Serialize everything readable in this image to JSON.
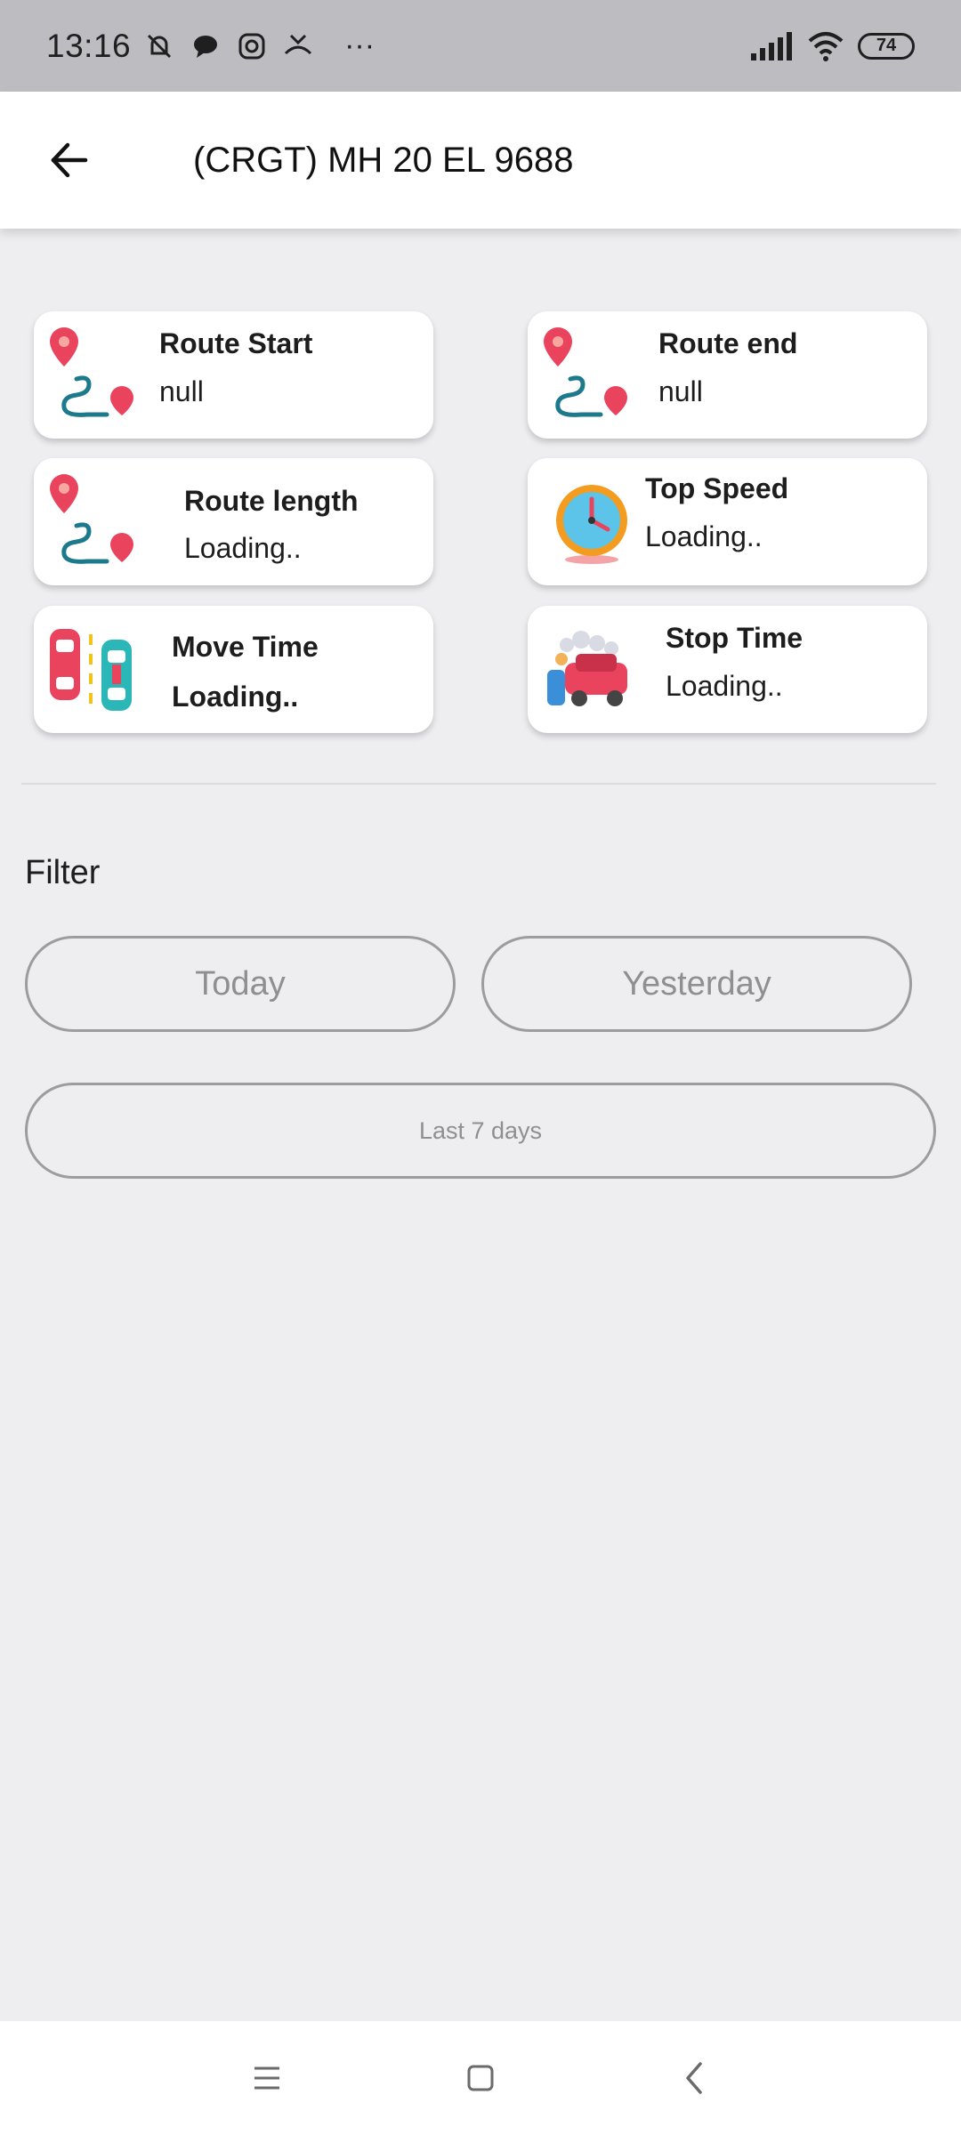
{
  "status_bar": {
    "time": "13:16",
    "battery": "74",
    "icons": [
      "muted-bell-icon",
      "chat-bubble-icon",
      "instagram-icon",
      "missed-call-icon",
      "more-dots-icon",
      "signal-icon",
      "wifi-icon",
      "battery-icon"
    ]
  },
  "app_bar": {
    "title": "(CRGT)  MH 20 EL 9688",
    "back_icon": "arrow-left-icon"
  },
  "cards": [
    {
      "label": "Route Start",
      "value": "null",
      "icon": "route-pin-icon"
    },
    {
      "label": "Route end",
      "value": "null",
      "icon": "route-pin-icon"
    },
    {
      "label": "Route length",
      "value": "Loading..",
      "icon": "route-pin-icon"
    },
    {
      "label": "Top Speed",
      "value": "Loading..",
      "icon": "clock-icon"
    },
    {
      "label": "Move Time",
      "value": "Loading..",
      "icon": "cars-road-icon"
    },
    {
      "label": "Stop Time",
      "value": "Loading..",
      "icon": "car-wash-icon"
    }
  ],
  "filter": {
    "label": "Filter",
    "today": "Today",
    "yesterday": "Yesterday",
    "last7": "Last 7 days"
  },
  "colors": {
    "pin": "#e9435e",
    "route": "#1c7a8c",
    "pill_border": "#9c9c9c",
    "background": "#eeedf0"
  }
}
